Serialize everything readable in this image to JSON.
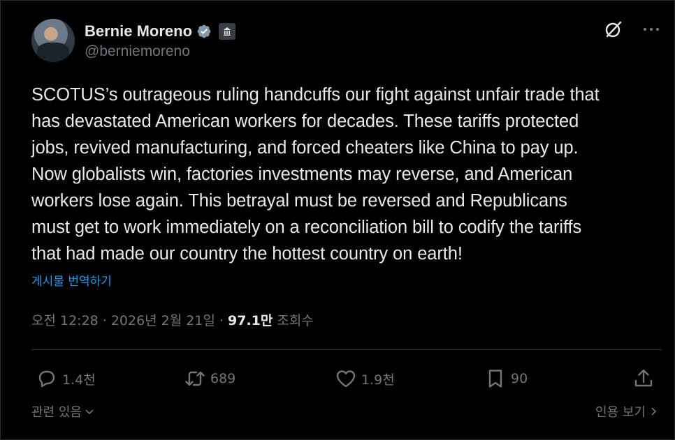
{
  "author": {
    "display_name": "Bernie Moreno",
    "handle": "@berniemoreno"
  },
  "tweet": {
    "text": "SCOTUS’s outrageous ruling handcuffs our fight against unfair trade that\nhas devastated American workers for decades. These tariffs protected\njobs, revived manufacturing, and forced cheaters like China to pay up.\nNow globalists win, factories investments may reverse, and American\nworkers lose again. This betrayal must be reversed and Republicans\nmust get to work immediately on a reconciliation bill to codify the tariffs\nthat had made our country the hottest country on earth!",
    "translate_label": "게시물 번역하기"
  },
  "meta": {
    "time": "오전 12:28",
    "separator": "·",
    "date": "2026년 2월 21일",
    "views_count": "97.1만",
    "views_label": "조회수"
  },
  "actions": {
    "reply_count": "1.4천",
    "repost_count": "689",
    "like_count": "1.9천",
    "bookmark_count": "90"
  },
  "footer": {
    "related_label": "관련 있음",
    "quotes_label": "인용 보기"
  },
  "colors": {
    "background": "#000000",
    "text": "#e7e9ea",
    "muted": "#71767b",
    "link": "#1d9bf0",
    "verified": "#829aab"
  },
  "icons": {
    "verified": "verified-badge-icon",
    "government": "government-building-icon",
    "grok": "grok-icon",
    "more": "more-dots-icon",
    "reply": "reply-bubble-icon",
    "repost": "repost-arrows-icon",
    "like": "heart-icon",
    "bookmark": "bookmark-icon",
    "share": "share-upload-icon"
  }
}
